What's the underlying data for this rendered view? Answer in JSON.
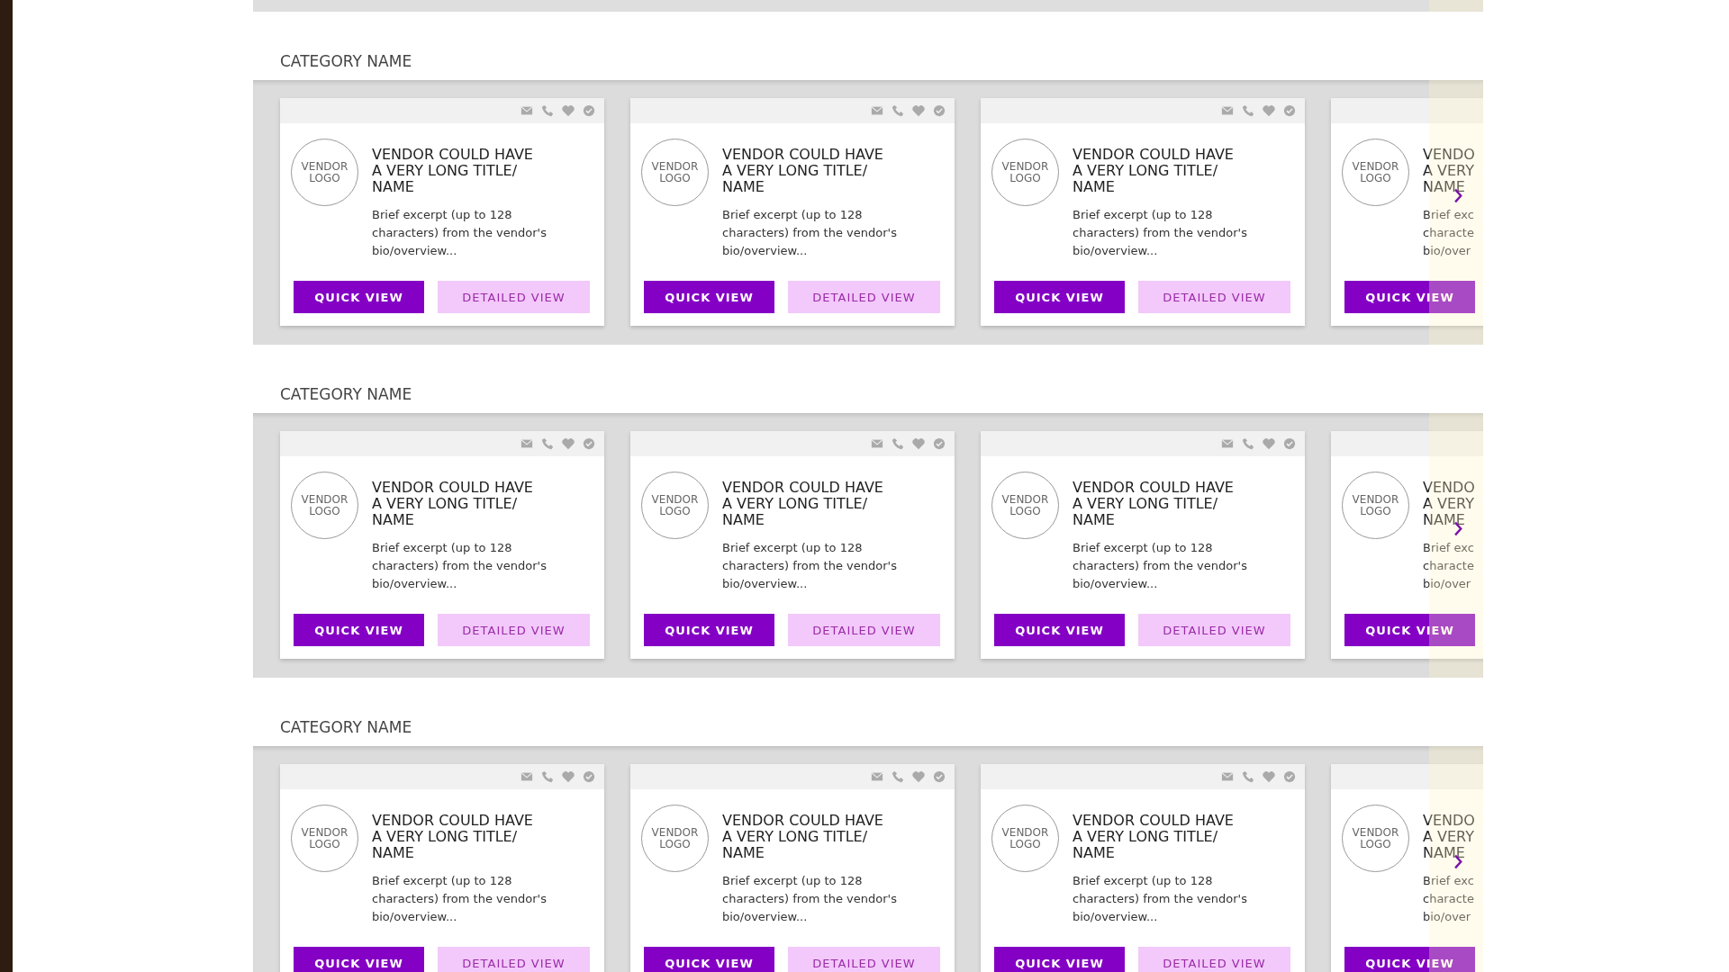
{
  "sections": [
    {
      "title": "CATEGORY NAME",
      "cards": [
        {
          "logo": "VENDOR LOGO",
          "title": "VENDOR COULD HAVE A VERY LONG TITLE/ NAME",
          "excerpt": "Brief excerpt (up to 128 characters) from the vendor's bio/overview...",
          "buttons": [
            {
              "label": "QUICK VIEW",
              "kind": "primary"
            },
            {
              "label": "DETAILED VIEW",
              "kind": "secondary"
            }
          ]
        },
        {
          "logo": "VENDOR LOGO",
          "title": "VENDOR COULD HAVE A VERY LONG TITLE/ NAME",
          "excerpt": "Brief excerpt (up to 128 characters) from the vendor's bio/overview...",
          "buttons": [
            {
              "label": "QUICK VIEW",
              "kind": "primary"
            },
            {
              "label": "DETAILED VIEW",
              "kind": "secondary"
            }
          ]
        },
        {
          "logo": "VENDOR LOGO",
          "title": "VENDOR COULD HAVE A VERY LONG TITLE/ NAME",
          "excerpt": "Brief excerpt (up to 128 characters) from the vendor's bio/overview...",
          "buttons": [
            {
              "label": "QUICK VIEW",
              "kind": "primary"
            },
            {
              "label": "DETAILED VIEW",
              "kind": "secondary"
            }
          ]
        }
      ],
      "partial_card": {
        "logo": "VENDOR LOGO",
        "title_lines": [
          "VENDO",
          "A VERY",
          "NAME"
        ],
        "excerpt_lines": [
          "Brief exc",
          "characte",
          "bio/over"
        ],
        "button": "QUICK VIEW"
      }
    },
    {
      "title": "CATEGORY NAME",
      "cards": [
        {
          "logo": "VENDOR LOGO",
          "title": "VENDOR COULD HAVE A VERY LONG TITLE/ NAME",
          "excerpt": "Brief excerpt (up to 128 characters) from the vendor's bio/overview...",
          "buttons": [
            {
              "label": "QUICK VIEW",
              "kind": "primary"
            },
            {
              "label": "DETAILED VIEW",
              "kind": "secondary"
            }
          ]
        },
        {
          "logo": "VENDOR LOGO",
          "title": "VENDOR COULD HAVE A VERY LONG TITLE/ NAME",
          "excerpt": "Brief excerpt (up to 128 characters) from the vendor's bio/overview...",
          "buttons": [
            {
              "label": "QUICK VIEW",
              "kind": "primary"
            },
            {
              "label": "DETAILED VIEW",
              "kind": "secondary"
            }
          ]
        },
        {
          "logo": "VENDOR LOGO",
          "title": "VENDOR COULD HAVE A VERY LONG TITLE/ NAME",
          "excerpt": "Brief excerpt (up to 128 characters) from the vendor's bio/overview...",
          "buttons": [
            {
              "label": "QUICK VIEW",
              "kind": "primary"
            },
            {
              "label": "DETAILED VIEW",
              "kind": "secondary"
            }
          ]
        }
      ],
      "partial_card": {
        "logo": "VENDOR LOGO",
        "title_lines": [
          "VENDO",
          "A VERY",
          "NAME"
        ],
        "excerpt_lines": [
          "Brief exc",
          "characte",
          "bio/over"
        ],
        "button": "QUICK VIEW"
      }
    },
    {
      "title": "CATEGORY NAME",
      "cards": [
        {
          "logo": "VENDOR LOGO",
          "title": "VENDOR COULD HAVE A VERY LONG TITLE/ NAME",
          "excerpt": "Brief excerpt (up to 128 characters) from the vendor's bio/overview...",
          "buttons": [
            {
              "label": "QUICK VIEW",
              "kind": "primary"
            },
            {
              "label": "DETAILED VIEW",
              "kind": "secondary"
            }
          ]
        },
        {
          "logo": "VENDOR LOGO",
          "title": "VENDOR COULD HAVE A VERY LONG TITLE/ NAME",
          "excerpt": "Brief excerpt (up to 128 characters) from the vendor's bio/overview...",
          "buttons": [
            {
              "label": "QUICK VIEW",
              "kind": "primary"
            },
            {
              "label": "DETAILED VIEW",
              "kind": "secondary"
            }
          ]
        },
        {
          "logo": "VENDOR LOGO",
          "title": "VENDOR COULD HAVE A VERY LONG TITLE/ NAME",
          "excerpt": "Brief excerpt (up to 128 characters) from the vendor's bio/overview...",
          "buttons": [
            {
              "label": "QUICK VIEW",
              "kind": "primary"
            },
            {
              "label": "DETAILED VIEW",
              "kind": "secondary"
            }
          ]
        }
      ],
      "partial_card": {
        "logo": "VENDOR LOGO",
        "title_lines": [
          "VENDO",
          "A VERY",
          "NAME"
        ],
        "excerpt_lines": [
          "Brief exc",
          "characte",
          "bio/over"
        ],
        "button": "QUICK VIEW"
      }
    }
  ]
}
